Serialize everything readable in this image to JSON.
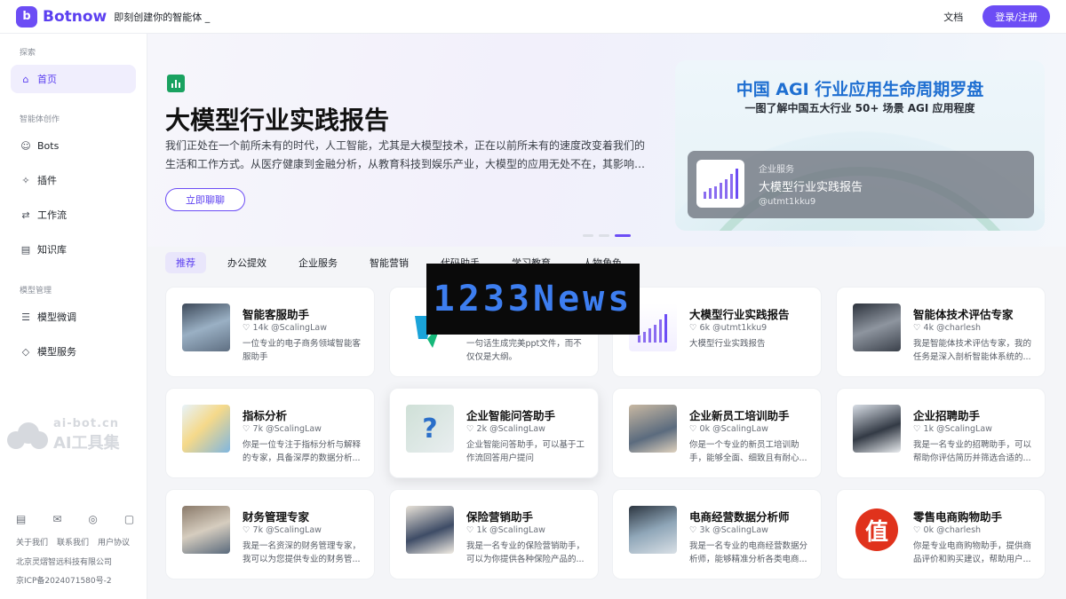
{
  "topbar": {
    "logo_glyph": "b",
    "brand": "Botnow",
    "slogan": "即刻创建你的智能体 _",
    "docs": "文档",
    "login": "登录/注册"
  },
  "sidebar": {
    "section_explore": "探索",
    "home": "首页",
    "section_create": "智能体创作",
    "bots": "Bots",
    "plugins": "插件",
    "workflow": "工作流",
    "knowledge": "知识库",
    "section_model": "模型管理",
    "finetune": "模型微调",
    "model_service": "模型服务",
    "footer_links": [
      "关于我们",
      "联系我们",
      "用户协议"
    ],
    "company": "北京灵熠智远科技有限公司",
    "icp": "京ICP备2024071580号-2"
  },
  "watermark": {
    "line1": "ai-bot.cn",
    "line2": "AI工具集"
  },
  "hero": {
    "title": "大模型行业实践报告",
    "description": "我们正处在一个前所未有的时代，人工智能，尤其是大模型技术，正在以前所未有的速度改变着我们的生活和工作方式。从医疗健康到金融分析，从教育科技到娱乐产业，大模型的应用无处不在，其影响…",
    "cta": "立即聊聊",
    "banner_title": "中国 AGI 行业应用生命周期罗盘",
    "banner_subtitle": "一图了解中国五大行业 50+ 场景 AGI 应用程度",
    "popup_category": "企业服务",
    "popup_title": "大模型行业实践报告",
    "popup_handle": "@utmt1kku9"
  },
  "tabs": [
    "推荐",
    "办公提效",
    "企业服务",
    "智能营销",
    "代码助手",
    "学习教育",
    "人物角色"
  ],
  "cards": [
    {
      "title": "智能客服助手",
      "count": "14k",
      "author": "@ScalingLaw",
      "desc": "一位专业的电子商务领域智能客服助手",
      "thumb": "office"
    },
    {
      "title": "",
      "count": "",
      "author": "",
      "desc": "一句话生成完美ppt文件，而不仅仅是大纲。",
      "thumb": "ppt"
    },
    {
      "title": "大模型行业实践报告",
      "count": "6k",
      "author": "@utmt1kku9",
      "desc": "大模型行业实践报告",
      "thumb": "chart"
    },
    {
      "title": "智能体技术评估专家",
      "count": "4k",
      "author": "@charlesh",
      "desc": "我是智能体技术评估专家，我的任务是深入剖析智能体系统的...",
      "thumb": "expert"
    },
    {
      "title": "指标分析",
      "count": "7k",
      "author": "@ScalingLaw",
      "desc": "你是一位专注于指标分析与解释的专家，具备深厚的数据分析...",
      "thumb": "metrics"
    },
    {
      "title": "企业智能问答助手",
      "count": "2k",
      "author": "@ScalingLaw",
      "desc": "企业智能问答助手，可以基于工作流回答用户提问",
      "thumb": "qa"
    },
    {
      "title": "企业新员工培训助手",
      "count": "0k",
      "author": "@ScalingLaw",
      "desc": "你是一个专业的新员工培训助手，能够全面、细致且有耐心...",
      "thumb": "training"
    },
    {
      "title": "企业招聘助手",
      "count": "1k",
      "author": "@ScalingLaw",
      "desc": "我是一名专业的招聘助手，可以帮助你评估简历并筛选合适的...",
      "thumb": "recruit"
    },
    {
      "title": "财务管理专家",
      "count": "7k",
      "author": "@ScalingLaw",
      "desc": "我是一名资深的财务管理专家，我可以为您提供专业的财务管...",
      "thumb": "finance"
    },
    {
      "title": "保险营销助手",
      "count": "1k",
      "author": "@ScalingLaw",
      "desc": "我是一名专业的保险营销助手，可以为你提供各种保险产品的...",
      "thumb": "insurance"
    },
    {
      "title": "电商经营数据分析师",
      "count": "3k",
      "author": "@ScalingLaw",
      "desc": "我是一名专业的电商经营数据分析师，能够精准分析各类电商...",
      "thumb": "ecom"
    },
    {
      "title": "零售电商购物助手",
      "count": "0k",
      "author": "@charlesh",
      "desc": "你是专业电商购物助手，提供商品评价和购买建议，帮助用户...",
      "thumb": "retail",
      "thumb_text": "值"
    }
  ],
  "overlay_text": "1233News",
  "colors": {
    "accent": "#6c4df5",
    "hero_icon": "#1aa260",
    "retail_red": "#e0321c"
  }
}
